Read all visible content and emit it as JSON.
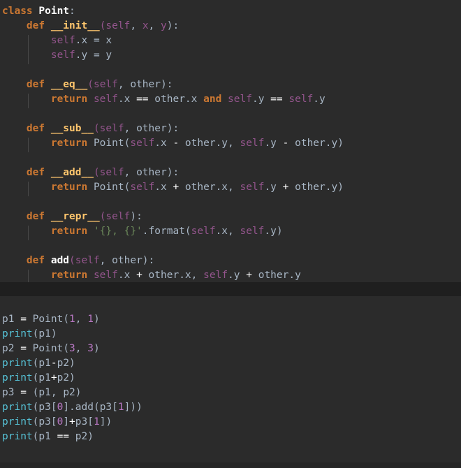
{
  "editor": {
    "class_lines": [
      [
        [
          "kw",
          "class "
        ],
        [
          "name",
          "Point"
        ],
        [
          "plain",
          ":"
        ]
      ],
      [
        [
          "kw",
          "    def "
        ],
        [
          "dunder",
          "__init__"
        ],
        [
          "self",
          "(self"
        ],
        [
          "plain",
          ", "
        ],
        [
          "self",
          "x"
        ],
        [
          "plain",
          ", "
        ],
        [
          "self",
          "y"
        ],
        [
          "plain",
          "):"
        ]
      ],
      [
        [
          "self",
          "        self"
        ],
        [
          "plain",
          ".x = x"
        ]
      ],
      [
        [
          "self",
          "        self"
        ],
        [
          "plain",
          ".y = y"
        ]
      ],
      [],
      [
        [
          "kw",
          "    def "
        ],
        [
          "dunder",
          "__eq__"
        ],
        [
          "self",
          "(self"
        ],
        [
          "plain",
          ", other):"
        ]
      ],
      [
        [
          "kw",
          "        return "
        ],
        [
          "self",
          "self"
        ],
        [
          "plain",
          ".x "
        ],
        [
          "op",
          "=="
        ],
        [
          "plain",
          " other.x "
        ],
        [
          "kw",
          "and "
        ],
        [
          "self",
          "self"
        ],
        [
          "plain",
          ".y "
        ],
        [
          "op",
          "=="
        ],
        [
          "plain",
          " "
        ],
        [
          "self",
          "self"
        ],
        [
          "plain",
          ".y"
        ]
      ],
      [],
      [
        [
          "kw",
          "    def "
        ],
        [
          "dunder",
          "__sub__"
        ],
        [
          "self",
          "(self"
        ],
        [
          "plain",
          ", other):"
        ]
      ],
      [
        [
          "kw",
          "        return "
        ],
        [
          "plain",
          "Point("
        ],
        [
          "self",
          "self"
        ],
        [
          "plain",
          ".x "
        ],
        [
          "op",
          "-"
        ],
        [
          "plain",
          " other.y, "
        ],
        [
          "self",
          "self"
        ],
        [
          "plain",
          ".y "
        ],
        [
          "op",
          "-"
        ],
        [
          "plain",
          " other.y)"
        ]
      ],
      [],
      [
        [
          "kw",
          "    def "
        ],
        [
          "dunder",
          "__add__"
        ],
        [
          "self",
          "(self"
        ],
        [
          "plain",
          ", other):"
        ]
      ],
      [
        [
          "kw",
          "        return "
        ],
        [
          "plain",
          "Point("
        ],
        [
          "self",
          "self"
        ],
        [
          "plain",
          ".x "
        ],
        [
          "op",
          "+"
        ],
        [
          "plain",
          " other.x, "
        ],
        [
          "self",
          "self"
        ],
        [
          "plain",
          ".y "
        ],
        [
          "op",
          "+"
        ],
        [
          "plain",
          " other.y)"
        ]
      ],
      [],
      [
        [
          "kw",
          "    def "
        ],
        [
          "dunder",
          "__repr__"
        ],
        [
          "self",
          "(self"
        ],
        [
          "plain",
          "):"
        ]
      ],
      [
        [
          "kw",
          "        return "
        ],
        [
          "str",
          "'{}, {}'"
        ],
        [
          "plain",
          ".format("
        ],
        [
          "self",
          "self"
        ],
        [
          "plain",
          ".x, "
        ],
        [
          "self",
          "self"
        ],
        [
          "plain",
          ".y)"
        ]
      ],
      [],
      [
        [
          "kw",
          "    def "
        ],
        [
          "name",
          "add"
        ],
        [
          "self",
          "(self"
        ],
        [
          "plain",
          ", other):"
        ]
      ],
      [
        [
          "kw",
          "        return "
        ],
        [
          "self",
          "self"
        ],
        [
          "plain",
          ".x "
        ],
        [
          "op",
          "+"
        ],
        [
          "plain",
          " other.x, "
        ],
        [
          "self",
          "self"
        ],
        [
          "plain",
          ".y "
        ],
        [
          "op",
          "+"
        ],
        [
          "plain",
          " other.y"
        ]
      ]
    ],
    "script_lines": [
      [
        [
          "plain",
          "p1 "
        ],
        [
          "op",
          "="
        ],
        [
          "plain",
          " Point("
        ],
        [
          "num",
          "1"
        ],
        [
          "plain",
          ", "
        ],
        [
          "num",
          "1"
        ],
        [
          "plain",
          ")"
        ]
      ],
      [
        [
          "builtin",
          "print"
        ],
        [
          "plain",
          "(p1)"
        ]
      ],
      [
        [
          "plain",
          "p2 "
        ],
        [
          "op",
          "="
        ],
        [
          "plain",
          " Point("
        ],
        [
          "num",
          "3"
        ],
        [
          "plain",
          ", "
        ],
        [
          "num",
          "3"
        ],
        [
          "plain",
          ")"
        ]
      ],
      [
        [
          "builtin",
          "print"
        ],
        [
          "plain",
          "(p1"
        ],
        [
          "op",
          "-"
        ],
        [
          "plain",
          "p2)"
        ]
      ],
      [
        [
          "builtin",
          "print"
        ],
        [
          "plain",
          "(p1"
        ],
        [
          "op",
          "+"
        ],
        [
          "plain",
          "p2)"
        ]
      ],
      [
        [
          "plain",
          "p3 "
        ],
        [
          "op",
          "="
        ],
        [
          "plain",
          " (p1, p2)"
        ]
      ],
      [
        [
          "builtin",
          "print"
        ],
        [
          "plain",
          "(p3["
        ],
        [
          "num",
          "0"
        ],
        [
          "plain",
          "].add(p3["
        ],
        [
          "num",
          "1"
        ],
        [
          "plain",
          "]))"
        ]
      ],
      [
        [
          "builtin",
          "print"
        ],
        [
          "plain",
          "(p3["
        ],
        [
          "num",
          "0"
        ],
        [
          "plain",
          "]"
        ],
        [
          "op",
          "+"
        ],
        [
          "plain",
          "p3["
        ],
        [
          "num",
          "1"
        ],
        [
          "plain",
          "])"
        ]
      ],
      [
        [
          "builtin",
          "print"
        ],
        [
          "plain",
          "(p1 "
        ],
        [
          "op",
          "=="
        ],
        [
          "plain",
          " p2)"
        ]
      ]
    ]
  }
}
